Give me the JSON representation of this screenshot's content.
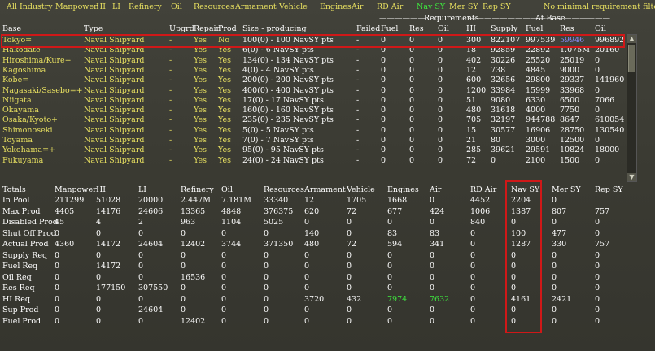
{
  "tabs": [
    {
      "label": "All Industry",
      "color": "y"
    },
    {
      "label": "Manpower",
      "color": "y"
    },
    {
      "label": "HI",
      "color": "y"
    },
    {
      "label": "LI",
      "color": "y"
    },
    {
      "label": "Refinery",
      "color": "y"
    },
    {
      "label": "Oil",
      "color": "y"
    },
    {
      "label": "Resources",
      "color": "y"
    },
    {
      "label": "Armament",
      "color": "y"
    },
    {
      "label": "Vehicle",
      "color": "y"
    },
    {
      "label": "Engines",
      "color": "y"
    },
    {
      "label": "Air",
      "color": "y"
    },
    {
      "label": "RD Air",
      "color": "y"
    },
    {
      "label": "Nav SY",
      "color": "g"
    },
    {
      "label": "Mer SY",
      "color": "y"
    },
    {
      "label": "Rep SY",
      "color": "y"
    },
    {
      "label": "No minimal requirement filter",
      "color": "y"
    }
  ],
  "group_headers": {
    "requirements": "Requirements",
    "at_base": "At Base"
  },
  "base_columns": [
    "Base",
    "Type",
    "Upgrd",
    "Repair",
    "Prod",
    "Size - producing",
    "Failed",
    "Fuel",
    "Res",
    "Oil",
    "HI",
    "Supply",
    "Fuel",
    "Res",
    "Oil"
  ],
  "bases": [
    [
      "Tokyo=",
      "Naval Shipyard",
      "-",
      "Yes",
      "No",
      "100(0) - 100 NavSY pts",
      "-",
      "0",
      "0",
      "0",
      "300",
      "822107",
      "997539",
      "59946",
      "996892"
    ],
    [
      "Hakodate",
      "Naval Shipyard",
      "-",
      "Yes",
      "Yes",
      "6(0) - 6 NavSY pts",
      "-",
      "0",
      "0",
      "0",
      "18",
      "92859",
      "22892",
      "1.075M",
      "20160"
    ],
    [
      "Hiroshima/Kure+",
      "Naval Shipyard",
      "-",
      "Yes",
      "Yes",
      "134(0) - 134 NavSY pts",
      "-",
      "0",
      "0",
      "0",
      "402",
      "30226",
      "25520",
      "25019",
      "0"
    ],
    [
      "Kagoshima",
      "Naval Shipyard",
      "-",
      "Yes",
      "Yes",
      "4(0) - 4 NavSY pts",
      "-",
      "0",
      "0",
      "0",
      "12",
      "738",
      "4845",
      "9000",
      "0"
    ],
    [
      "Kobe=",
      "Naval Shipyard",
      "-",
      "Yes",
      "Yes",
      "200(0) - 200 NavSY pts",
      "-",
      "0",
      "0",
      "0",
      "600",
      "32656",
      "29800",
      "29337",
      "141960"
    ],
    [
      "Nagasaki/Sasebo=+",
      "Naval Shipyard",
      "-",
      "Yes",
      "Yes",
      "400(0) - 400 NavSY pts",
      "-",
      "0",
      "0",
      "0",
      "1200",
      "33984",
      "15999",
      "33968",
      "0"
    ],
    [
      "Niigata",
      "Naval Shipyard",
      "-",
      "Yes",
      "Yes",
      "17(0) - 17 NavSY pts",
      "-",
      "0",
      "0",
      "0",
      "51",
      "9080",
      "6330",
      "6500",
      "7066"
    ],
    [
      "Okayama",
      "Naval Shipyard",
      "-",
      "Yes",
      "Yes",
      "160(0) - 160 NavSY pts",
      "-",
      "0",
      "0",
      "0",
      "480",
      "31618",
      "4000",
      "7750",
      "0"
    ],
    [
      "Osaka/Kyoto+",
      "Naval Shipyard",
      "-",
      "Yes",
      "Yes",
      "235(0) - 235 NavSY pts",
      "-",
      "0",
      "0",
      "0",
      "705",
      "32197",
      "944788",
      "8647",
      "610054"
    ],
    [
      "Shimonoseki",
      "Naval Shipyard",
      "-",
      "Yes",
      "Yes",
      "5(0) - 5 NavSY pts",
      "-",
      "0",
      "0",
      "0",
      "15",
      "30577",
      "16906",
      "28750",
      "130540"
    ],
    [
      "Toyama",
      "Naval Shipyard",
      "-",
      "Yes",
      "Yes",
      "7(0) - 7 NavSY pts",
      "-",
      "0",
      "0",
      "0",
      "21",
      "80",
      "3000",
      "12500",
      "0"
    ],
    [
      "Yokohama=+",
      "Naval Shipyard",
      "-",
      "Yes",
      "Yes",
      "95(0) - 95 NavSY pts",
      "-",
      "0",
      "0",
      "0",
      "285",
      "39621",
      "29591",
      "10824",
      "18000"
    ],
    [
      "Fukuyama",
      "Naval Shipyard",
      "-",
      "Yes",
      "Yes",
      "24(0) - 24 NavSY pts",
      "-",
      "0",
      "0",
      "0",
      "72",
      "0",
      "2100",
      "1500",
      "0"
    ]
  ],
  "totals_columns": [
    "Totals",
    "Manpower",
    "HI",
    "LI",
    "Refinery",
    "Oil",
    "Resources",
    "Armament",
    "Vehicle",
    "Engines",
    "Air",
    "RD Air",
    "Nav SY",
    "Mer SY",
    "Rep SY"
  ],
  "totals": [
    [
      "In Pool",
      "211299",
      "51028",
      "20000",
      "2.447M",
      "7.181M",
      "33340",
      "12",
      "1705",
      "1668",
      "0",
      "4452",
      "2204",
      "0"
    ],
    [
      "Max Prod",
      "4405",
      "14176",
      "24606",
      "13365",
      "4848",
      "376375",
      "620",
      "72",
      "677",
      "424",
      "1006",
      "1387",
      "807",
      "757"
    ],
    [
      "Disabled Prod",
      "45",
      "4",
      "2",
      "963",
      "1104",
      "5025",
      "0",
      "0",
      "0",
      "0",
      "840",
      "0",
      "0",
      "0"
    ],
    [
      "Shut Off Prod",
      "0",
      "0",
      "0",
      "0",
      "0",
      "0",
      "140",
      "0",
      "83",
      "83",
      "0",
      "100",
      "477",
      "0"
    ],
    [
      "Actual Prod",
      "4360",
      "14172",
      "24604",
      "12402",
      "3744",
      "371350",
      "480",
      "72",
      "594",
      "341",
      "0",
      "1287",
      "330",
      "757"
    ],
    [
      "Supply Req",
      "0",
      "0",
      "0",
      "0",
      "0",
      "0",
      "0",
      "0",
      "0",
      "0",
      "0",
      "0",
      "0",
      "0"
    ],
    [
      "Fuel Req",
      "0",
      "14172",
      "0",
      "0",
      "0",
      "0",
      "0",
      "0",
      "0",
      "0",
      "0",
      "0",
      "0",
      "0"
    ],
    [
      "Oil Req",
      "0",
      "0",
      "0",
      "16536",
      "0",
      "0",
      "0",
      "0",
      "0",
      "0",
      "0",
      "0",
      "0",
      "0"
    ],
    [
      "Res Req",
      "0",
      "177150",
      "307550",
      "0",
      "0",
      "0",
      "0",
      "0",
      "0",
      "0",
      "0",
      "0",
      "0",
      "0"
    ],
    [
      "HI Req",
      "0",
      "0",
      "0",
      "0",
      "0",
      "0",
      "3720",
      "432",
      "7974",
      "7632",
      "0",
      "4161",
      "2421",
      "0"
    ],
    [
      "Sup Prod",
      "0",
      "0",
      "24604",
      "0",
      "0",
      "0",
      "0",
      "0",
      "0",
      "0",
      "0",
      "0",
      "0",
      "0"
    ],
    [
      "Fuel Prod",
      "0",
      "0",
      "0",
      "12402",
      "0",
      "0",
      "0",
      "0",
      "0",
      "0",
      "0",
      "0",
      "0",
      "0"
    ]
  ],
  "colors": {
    "highlight_box": "#d01818",
    "yellow": "#e8e060",
    "green": "#3ee83e",
    "blue": "#8b8bff"
  }
}
